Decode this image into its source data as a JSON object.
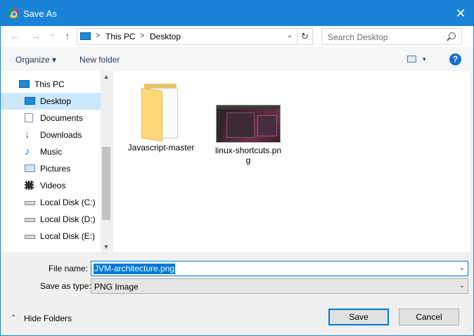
{
  "window": {
    "title": "Save As",
    "close_glyph": "✕",
    "app_icon": "chrome-icon"
  },
  "nav": {
    "back_glyph": "←",
    "forward_glyph": "→",
    "recent_glyph": "⌄",
    "up_glyph": "↑"
  },
  "address": {
    "crumbs": [
      "This PC",
      "Desktop"
    ],
    "separator": ">",
    "dropdown_glyph": "⌄",
    "refresh_glyph": "↻"
  },
  "search": {
    "placeholder": "Search Desktop"
  },
  "toolbar": {
    "organize_label": "Organize ▾",
    "new_folder_label": "New folder",
    "view_dropdown": "▾",
    "help_label": "?"
  },
  "sidebar": {
    "items": [
      {
        "label": "This PC",
        "icon": "pc-icon"
      },
      {
        "label": "Desktop",
        "icon": "desktop-icon",
        "selected": true
      },
      {
        "label": "Documents",
        "icon": "documents-icon"
      },
      {
        "label": "Downloads",
        "icon": "downloads-icon"
      },
      {
        "label": "Music",
        "icon": "music-icon"
      },
      {
        "label": "Pictures",
        "icon": "pictures-icon"
      },
      {
        "label": "Videos",
        "icon": "videos-icon"
      },
      {
        "label": "Local Disk (C:)",
        "icon": "drive-icon"
      },
      {
        "label": "Local Disk (D:)",
        "icon": "drive-icon"
      },
      {
        "label": "Local Disk (E:)",
        "icon": "drive-icon"
      }
    ],
    "scroll_up": "▲",
    "scroll_down": "▼"
  },
  "files": [
    {
      "name": "Javascript-master",
      "type": "folder"
    },
    {
      "name": "linux-shortcuts.png",
      "type": "image"
    }
  ],
  "form": {
    "file_name_label": "File name:",
    "file_name_value": "JVM-architecture.png",
    "save_type_label": "Save as type:",
    "save_type_value": "PNG Image",
    "dropdown_glyph": "⌄"
  },
  "footer": {
    "hide_folders_label": "Hide Folders",
    "hide_folders_glyph": "⌃",
    "save_label": "Save",
    "cancel_label": "Cancel"
  },
  "colors": {
    "accent": "#1883d7",
    "selection": "#cce8ff",
    "selected_text_bg": "#0078d7"
  }
}
